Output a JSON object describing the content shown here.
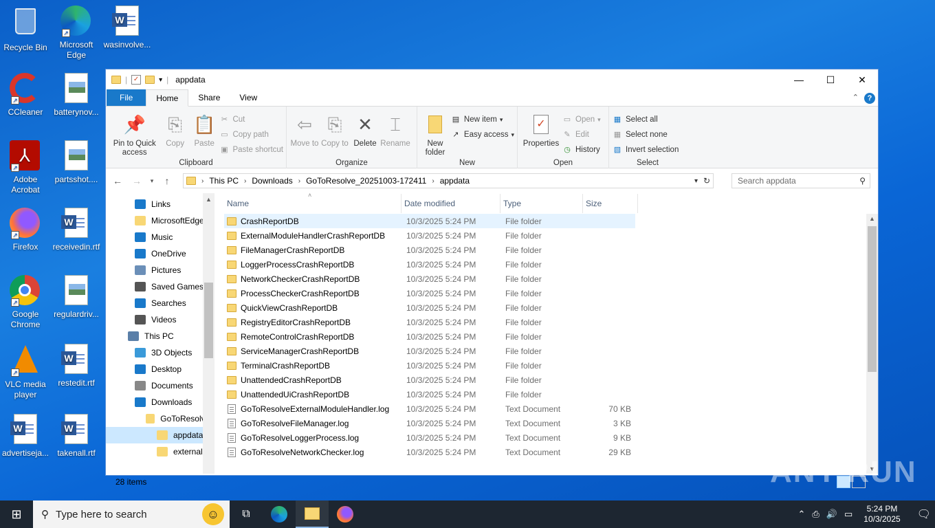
{
  "desktop": {
    "icons": [
      {
        "label": "Recycle Bin"
      },
      {
        "label": "Microsoft Edge"
      },
      {
        "label": "wasinvolve..."
      },
      {
        "label": "CCleaner"
      },
      {
        "label": "batterynov..."
      },
      {
        "label": "Adobe Acrobat"
      },
      {
        "label": "partsshot...."
      },
      {
        "label": "Firefox"
      },
      {
        "label": "receivedin.rtf"
      },
      {
        "label": "Google Chrome"
      },
      {
        "label": "regulardriv..."
      },
      {
        "label": "VLC media player"
      },
      {
        "label": "restedit.rtf"
      },
      {
        "label": "advertiseja..."
      },
      {
        "label": "takenall.rtf"
      }
    ]
  },
  "window": {
    "title": "appdata",
    "controls": {
      "minimize": "—",
      "maximize": "☐",
      "close": "✕"
    },
    "tabs": [
      {
        "label": "File"
      },
      {
        "label": "Home"
      },
      {
        "label": "Share"
      },
      {
        "label": "View"
      }
    ],
    "help": "?"
  },
  "ribbon": {
    "clipboard": {
      "label": "Clipboard",
      "pin": "Pin to Quick access",
      "copy": "Copy",
      "paste": "Paste",
      "cut": "Cut",
      "copy_path": "Copy path",
      "paste_shortcut": "Paste shortcut"
    },
    "organize": {
      "label": "Organize",
      "move_to": "Move to",
      "copy_to": "Copy to",
      "delete": "Delete",
      "rename": "Rename"
    },
    "new": {
      "label": "New",
      "new_folder": "New folder",
      "new_item": "New item",
      "easy_access": "Easy access"
    },
    "open": {
      "label": "Open",
      "properties": "Properties",
      "open": "Open",
      "edit": "Edit",
      "history": "History"
    },
    "select": {
      "label": "Select",
      "select_all": "Select all",
      "select_none": "Select none",
      "invert": "Invert selection"
    }
  },
  "address": {
    "path": [
      "This PC",
      "Downloads",
      "GoToResolve_20251003-172411",
      "appdata"
    ],
    "search_placeholder": "Search appdata"
  },
  "nav": {
    "items": [
      {
        "label": "Links",
        "indent": 1
      },
      {
        "label": "MicrosoftEdge",
        "indent": 1
      },
      {
        "label": "Music",
        "indent": 1
      },
      {
        "label": "OneDrive",
        "indent": 1
      },
      {
        "label": "Pictures",
        "indent": 1
      },
      {
        "label": "Saved Games",
        "indent": 1
      },
      {
        "label": "Searches",
        "indent": 1
      },
      {
        "label": "Videos",
        "indent": 1
      },
      {
        "label": "This PC",
        "indent": 0
      },
      {
        "label": "3D Objects",
        "indent": 1
      },
      {
        "label": "Desktop",
        "indent": 1
      },
      {
        "label": "Documents",
        "indent": 1
      },
      {
        "label": "Downloads",
        "indent": 1
      },
      {
        "label": "GoToResolve_",
        "indent": 2
      },
      {
        "label": "appdata",
        "indent": 3
      },
      {
        "label": "externalmo",
        "indent": 3
      }
    ]
  },
  "list": {
    "columns": [
      "Name",
      "Date modified",
      "Type",
      "Size"
    ],
    "rows": [
      {
        "name": "CrashReportDB",
        "date": "10/3/2025 5:24 PM",
        "type": "File folder",
        "size": "",
        "kind": "folder"
      },
      {
        "name": "ExternalModuleHandlerCrashReportDB",
        "date": "10/3/2025 5:24 PM",
        "type": "File folder",
        "size": "",
        "kind": "folder"
      },
      {
        "name": "FileManagerCrashReportDB",
        "date": "10/3/2025 5:24 PM",
        "type": "File folder",
        "size": "",
        "kind": "folder"
      },
      {
        "name": "LoggerProcessCrashReportDB",
        "date": "10/3/2025 5:24 PM",
        "type": "File folder",
        "size": "",
        "kind": "folder"
      },
      {
        "name": "NetworkCheckerCrashReportDB",
        "date": "10/3/2025 5:24 PM",
        "type": "File folder",
        "size": "",
        "kind": "folder"
      },
      {
        "name": "ProcessCheckerCrashReportDB",
        "date": "10/3/2025 5:24 PM",
        "type": "File folder",
        "size": "",
        "kind": "folder"
      },
      {
        "name": "QuickViewCrashReportDB",
        "date": "10/3/2025 5:24 PM",
        "type": "File folder",
        "size": "",
        "kind": "folder"
      },
      {
        "name": "RegistryEditorCrashReportDB",
        "date": "10/3/2025 5:24 PM",
        "type": "File folder",
        "size": "",
        "kind": "folder"
      },
      {
        "name": "RemoteControlCrashReportDB",
        "date": "10/3/2025 5:24 PM",
        "type": "File folder",
        "size": "",
        "kind": "folder"
      },
      {
        "name": "ServiceManagerCrashReportDB",
        "date": "10/3/2025 5:24 PM",
        "type": "File folder",
        "size": "",
        "kind": "folder"
      },
      {
        "name": "TerminalCrashReportDB",
        "date": "10/3/2025 5:24 PM",
        "type": "File folder",
        "size": "",
        "kind": "folder"
      },
      {
        "name": "UnattendedCrashReportDB",
        "date": "10/3/2025 5:24 PM",
        "type": "File folder",
        "size": "",
        "kind": "folder"
      },
      {
        "name": "UnattendedUiCrashReportDB",
        "date": "10/3/2025 5:24 PM",
        "type": "File folder",
        "size": "",
        "kind": "folder"
      },
      {
        "name": "GoToResolveExternalModuleHandler.log",
        "date": "10/3/2025 5:24 PM",
        "type": "Text Document",
        "size": "70 KB",
        "kind": "text"
      },
      {
        "name": "GoToResolveFileManager.log",
        "date": "10/3/2025 5:24 PM",
        "type": "Text Document",
        "size": "3 KB",
        "kind": "text"
      },
      {
        "name": "GoToResolveLoggerProcess.log",
        "date": "10/3/2025 5:24 PM",
        "type": "Text Document",
        "size": "9 KB",
        "kind": "text"
      },
      {
        "name": "GoToResolveNetworkChecker.log",
        "date": "10/3/2025 5:24 PM",
        "type": "Text Document",
        "size": "29 KB",
        "kind": "text"
      }
    ]
  },
  "status": {
    "items_count": "28 items"
  },
  "taskbar": {
    "search_placeholder": "Type here to search",
    "time": "5:24 PM",
    "date": "10/3/2025"
  },
  "watermark": "ANY RUN"
}
